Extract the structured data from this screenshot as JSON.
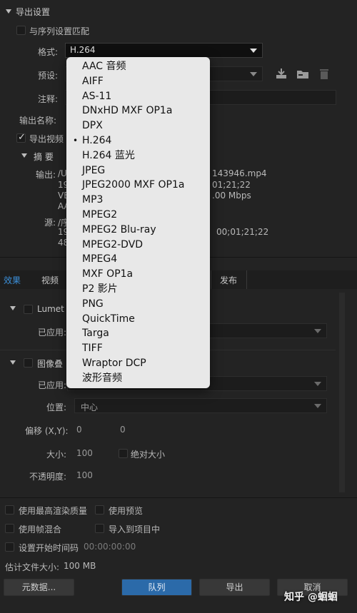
{
  "export_settings": {
    "section_title": "导出设置",
    "match_sequence_label": "与序列设置匹配",
    "format_label": "格式:",
    "format_value": "H.264",
    "preset_label": "预设:",
    "comments_label": "注释:",
    "output_name_label": "输出名称:",
    "export_video_label": "导出视频",
    "summary_label": "摘 要",
    "output_label": "输出:",
    "output_line1_start": "/U",
    "output_line1_end": "143946.mp4",
    "output_line2_start": "19",
    "output_line2_end": "01;21;22",
    "output_line3_start": "VE",
    "output_line3_end": ".00 Mbps",
    "output_line4_start": "AA",
    "source_label": "源:",
    "source_line1_start": "/序",
    "source_line2_start": "19",
    "source_line2_end": "00;01;21;22",
    "source_line3_start": "48"
  },
  "format_menu": {
    "items": [
      "AAC 音频",
      "AIFF",
      "AS-11",
      "DNxHD MXF OP1a",
      "DPX",
      "H.264",
      "H.264 蓝光",
      "JPEG",
      "JPEG2000 MXF OP1a",
      "MP3",
      "MPEG2",
      "MPEG2 Blu-ray",
      "MPEG2-DVD",
      "MPEG4",
      "MXF OP1a",
      "P2 影片",
      "PNG",
      "QuickTime",
      "Targa",
      "TIFF",
      "Wraptor DCP",
      "波形音频"
    ],
    "selected": "H.264",
    "bullet": "•"
  },
  "tabs": {
    "effects": "效果",
    "video": "视频",
    "publish": "发布"
  },
  "effects": {
    "lumetri_label": "Lumet",
    "applied_label_1": "已应用:",
    "image_overlay_label": "图像叠",
    "applied_label_2": "已应用:",
    "position_label": "位置:",
    "position_value": "中心",
    "offset_label": "偏移 (X,Y):",
    "offset_x": "0",
    "offset_y": "0",
    "size_label": "大小:",
    "size_value": "100",
    "absolute_size_label": "绝对大小",
    "opacity_label": "不透明度:",
    "opacity_value": "100"
  },
  "bottom": {
    "max_render_quality": "使用最高渲染质量",
    "use_previews": "使用预览",
    "frame_blending": "使用帧混合",
    "import_into_project": "导入到项目中",
    "set_start_timecode": "设置开始时间码",
    "timecode_value": "00:00:00:00",
    "estimated_size_label": "估计文件大小:",
    "estimated_size_value": "100 MB",
    "metadata_button": "元数据...",
    "queue_button": "队列",
    "export_button": "导出",
    "cancel_button": "取消"
  },
  "watermark": "知乎 @蛔蛔"
}
